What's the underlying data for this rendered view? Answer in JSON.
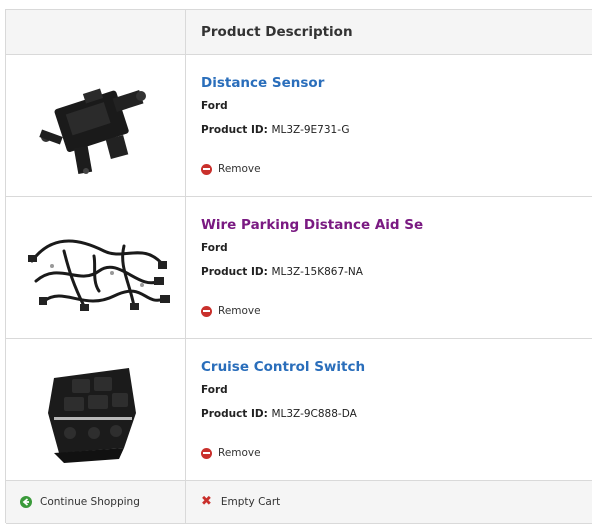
{
  "header": {
    "title": "Product Description"
  },
  "items": [
    {
      "name": "Distance Sensor",
      "brand": "Ford",
      "pid_label": "Product ID:",
      "pid": "ML3Z-9E731-G",
      "remove_label": "Remove",
      "image": "distance-sensor-image",
      "link_state": "link"
    },
    {
      "name": "Wire Parking Distance Aid Se",
      "brand": "Ford",
      "pid_label": "Product ID:",
      "pid": "ML3Z-15K867-NA",
      "remove_label": "Remove",
      "image": "wiring-harness-image",
      "link_state": "visited"
    },
    {
      "name": "Cruise Control Switch",
      "brand": "Ford",
      "pid_label": "Product ID:",
      "pid": "ML3Z-9C888-DA",
      "remove_label": "Remove",
      "image": "cruise-control-switch-image",
      "link_state": "link"
    }
  ],
  "footer": {
    "continue_label": "Continue Shopping",
    "empty_label": "Empty Cart"
  },
  "colors": {
    "link": "#2a6ebb",
    "visited_link": "#7a1a82",
    "remove_icon": "#c9302c",
    "continue_icon": "#3a9a3a",
    "header_bg": "#f5f5f5"
  },
  "icons": {
    "remove": "minus-circle-icon",
    "continue": "arrow-left-circle-icon",
    "empty": "x-icon"
  }
}
